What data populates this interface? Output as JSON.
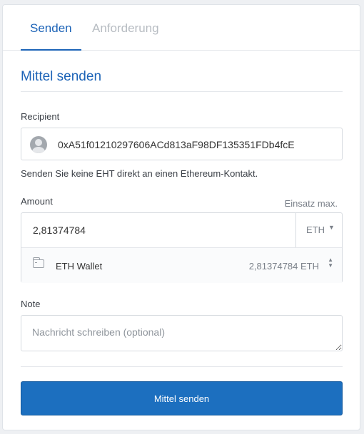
{
  "tabs": {
    "send": "Senden",
    "request": "Anforderung"
  },
  "section_title": "Mittel senden",
  "recipient": {
    "label": "Recipient",
    "address": "0xA51f01210297606ACd813aF98DF135351FDb4fcE",
    "warning": "Senden Sie keine EHT direkt an einen Ethereum-Kontakt."
  },
  "amount": {
    "label": "Amount",
    "max_link": "Einsatz max.",
    "value": "2,81374784",
    "currency": "ETH",
    "wallet_name": "ETH Wallet",
    "wallet_balance": "2,81374784 ETH"
  },
  "note": {
    "label": "Note",
    "placeholder": "Nachricht schreiben (optional)"
  },
  "submit_label": "Mittel senden",
  "colors": {
    "accent": "#1c63b7",
    "button": "#1c6fbf"
  }
}
